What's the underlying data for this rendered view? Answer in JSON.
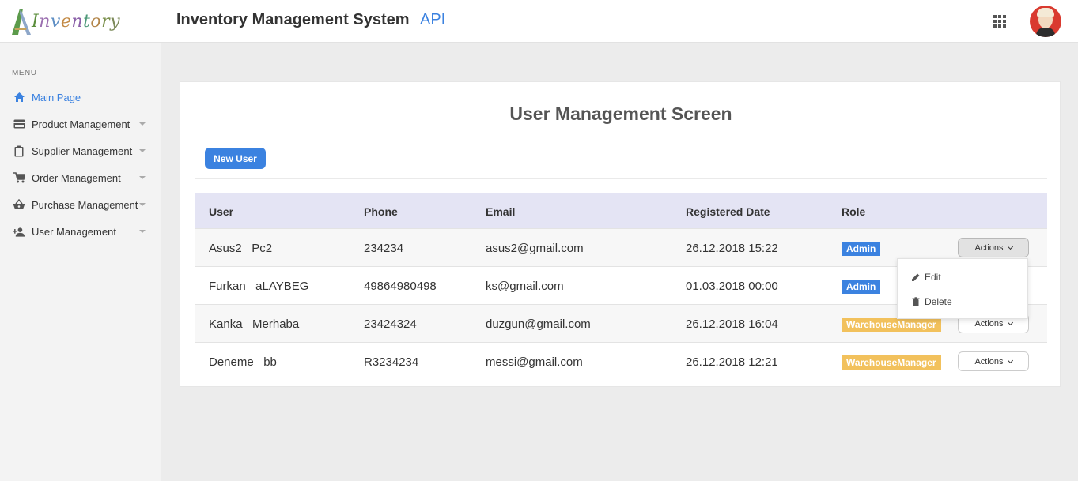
{
  "header": {
    "logo_text": "Inventory",
    "title": "Inventory Management System",
    "api_link": "API",
    "apps_icon": "grid-apps-icon",
    "avatar_icon": "user-avatar"
  },
  "sidebar": {
    "menu_label": "MENU",
    "items": [
      {
        "label": "Main Page",
        "icon": "home-icon",
        "active": true
      },
      {
        "label": "Product Management",
        "icon": "credit-card-icon"
      },
      {
        "label": "Supplier Management",
        "icon": "clipboard-icon"
      },
      {
        "label": "Order Management",
        "icon": "cart-icon"
      },
      {
        "label": "Purchase Management",
        "icon": "basket-icon"
      },
      {
        "label": "User Management",
        "icon": "user-add-icon"
      }
    ]
  },
  "main": {
    "title": "User Management Screen",
    "new_user_label": "New User",
    "table": {
      "headers": [
        "User",
        "Phone",
        "Email",
        "Registered Date",
        "Role"
      ],
      "rows": [
        {
          "user": "Asus2   Pc2",
          "phone": "234234",
          "email": "asus2@gmail.com",
          "date": "26.12.2018 15:22",
          "role": "Admin"
        },
        {
          "user": "Furkan   aLAYBEG",
          "phone": "49864980498",
          "email": "ks@gmail.com",
          "date": "01.03.2018 00:00",
          "role": "Admin"
        },
        {
          "user": "Kanka   Merhaba",
          "phone": "23424324",
          "email": "duzgun@gmail.com",
          "date": "26.12.2018 16:04",
          "role": "WarehouseManager"
        },
        {
          "user": "Deneme   bb",
          "phone": "R3234234",
          "email": "messi@gmail.com",
          "date": "26.12.2018 12:21",
          "role": "WarehouseManager"
        }
      ],
      "actions_label": "Actions"
    },
    "dropdown": {
      "items": [
        {
          "label": "Edit",
          "icon": "pencil-icon"
        },
        {
          "label": "Delete",
          "icon": "trash-icon"
        }
      ]
    }
  },
  "colors": {
    "accent": "#3b82e0",
    "admin_badge": "#3b82e0",
    "warehouse_badge": "#f2c15c",
    "table_header": "#e4e4f4"
  }
}
